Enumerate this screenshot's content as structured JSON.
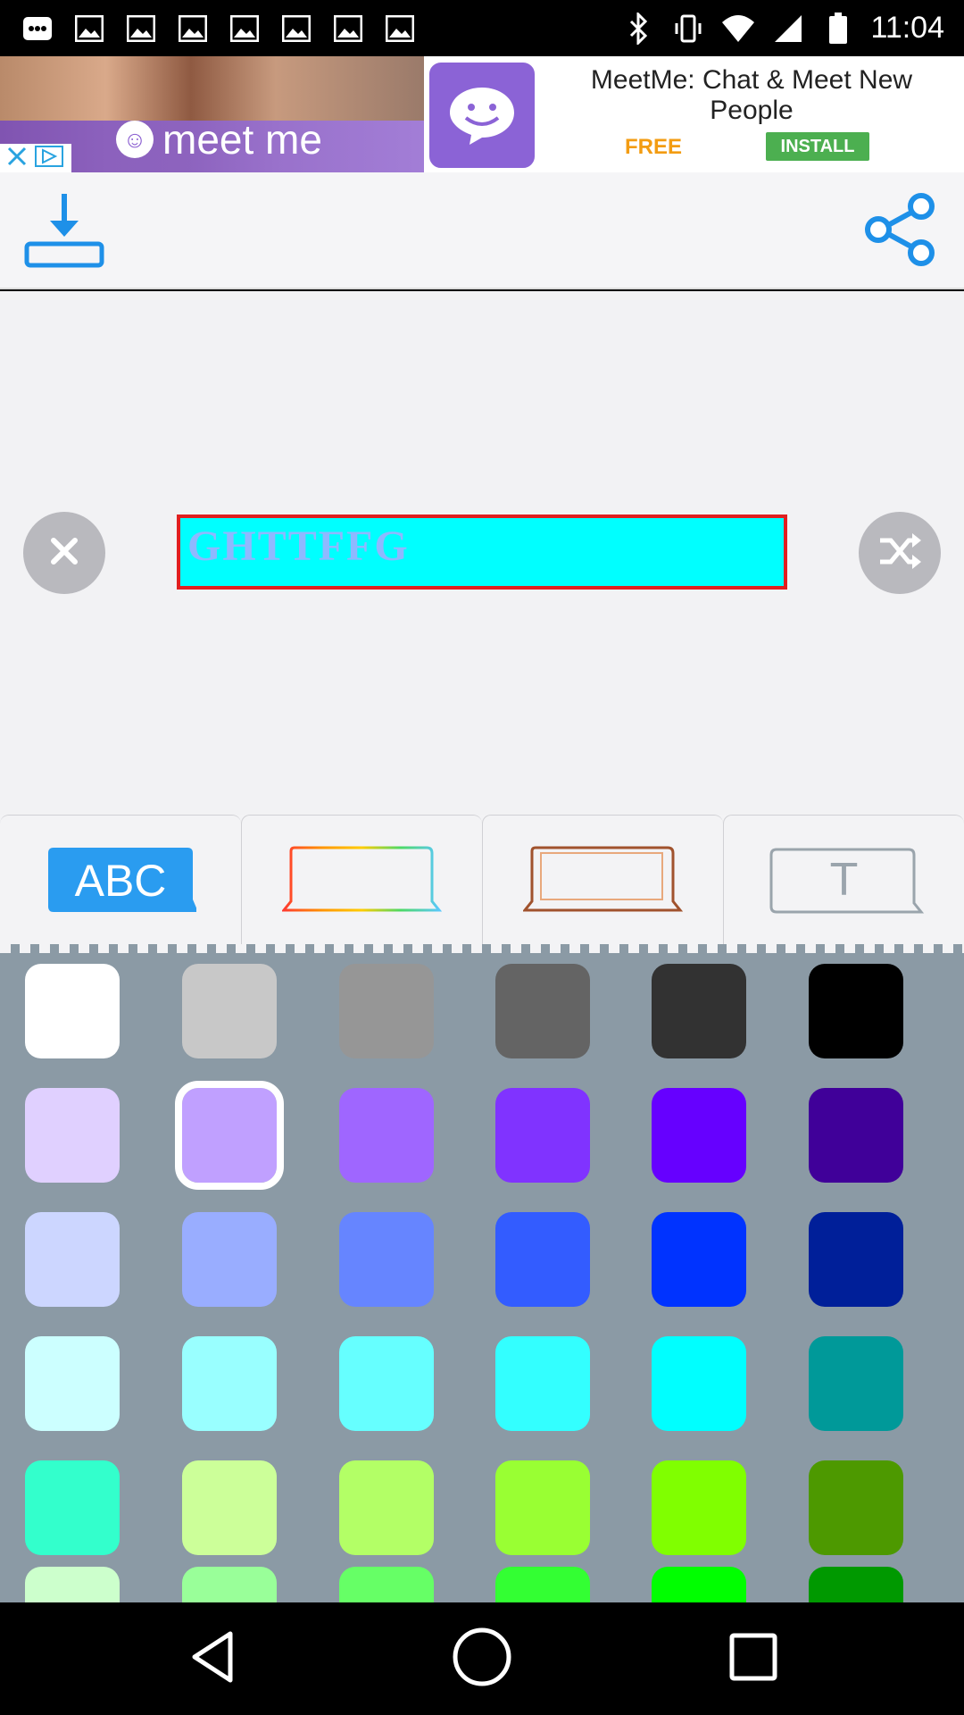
{
  "status_bar": {
    "time": "11:04",
    "left_icons": [
      "more-dots-icon",
      "image-icon",
      "image-icon",
      "image-icon",
      "image-icon",
      "image-icon",
      "image-icon",
      "image-icon"
    ],
    "right_icons": [
      "bluetooth-icon",
      "vibrate-icon",
      "wifi-icon",
      "signal-icon",
      "battery-icon"
    ]
  },
  "ad": {
    "brand": "meet me",
    "title": "MeetMe: Chat & Meet New People",
    "price": "FREE",
    "install_label": "INSTALL"
  },
  "toolbar": {
    "download_icon": "download-icon",
    "share_icon": "share-icon",
    "accent_color": "#1e90e8"
  },
  "canvas": {
    "text": "GHTTFFG",
    "text_box_bg": "#00ffff",
    "text_box_border": "#e02020",
    "close_icon": "close-icon",
    "shuffle_icon": "shuffle-icon"
  },
  "tabs": [
    {
      "name": "text-color",
      "label": "ABC"
    },
    {
      "name": "gradient-border",
      "label": ""
    },
    {
      "name": "frame-border",
      "label": ""
    },
    {
      "name": "font",
      "label": "T"
    }
  ],
  "palette": {
    "rows": [
      [
        "#ffffff",
        "#c8c8c8",
        "#969696",
        "#646464",
        "#323232",
        "#000000"
      ],
      [
        "#e0d0ff",
        "#c0a0ff",
        "#9f66ff",
        "#8033ff",
        "#6600ff",
        "#400099"
      ],
      [
        "#ccd6ff",
        "#99adff",
        "#6685ff",
        "#335cff",
        "#0033ff",
        "#001f99"
      ],
      [
        "#ccffff",
        "#99ffff",
        "#66ffff",
        "#33ffff",
        "#00ffff",
        "#009999"
      ],
      [
        "#33ffcc",
        "#ccff99",
        "#b3ff66",
        "#99ff33",
        "#80ff00",
        "#4d9900"
      ],
      [
        "#ccffcc",
        "#99ff99",
        "#66ff66",
        "#33ff33",
        "#00ff00",
        "#009900"
      ]
    ],
    "selected": "#c0a0ff"
  },
  "nav": [
    "back-icon",
    "home-icon",
    "recents-icon"
  ]
}
